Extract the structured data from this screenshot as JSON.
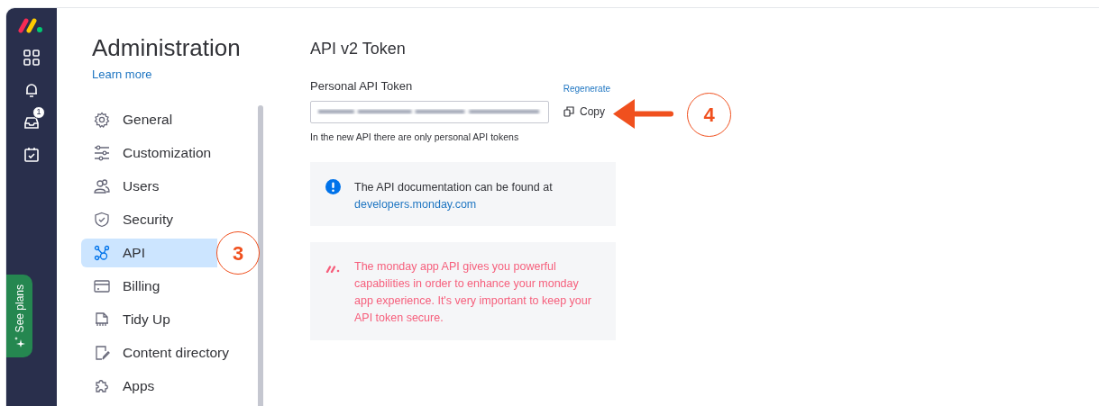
{
  "nav_rail": {
    "notification_badge": "1",
    "see_plans": "See plans"
  },
  "admin": {
    "title": "Administration",
    "learn_more": "Learn more",
    "items": [
      {
        "label": "General",
        "selected": false
      },
      {
        "label": "Customization",
        "selected": false
      },
      {
        "label": "Users",
        "selected": false
      },
      {
        "label": "Security",
        "selected": false
      },
      {
        "label": "API",
        "selected": true
      },
      {
        "label": "Billing",
        "selected": false
      },
      {
        "label": "Tidy Up",
        "selected": false
      },
      {
        "label": "Content directory",
        "selected": false
      },
      {
        "label": "Apps",
        "selected": false
      }
    ]
  },
  "main": {
    "title": "API v2 Token",
    "token_label": "Personal API Token",
    "regenerate": "Regenerate",
    "copy": "Copy",
    "hint": "In the new API there are only personal API tokens",
    "info": {
      "text": "The API documentation can be found at",
      "link": "developers.monday.com"
    },
    "notice": "The monday app API gives you powerful capabilities in order to enhance your monday app experience. It's very important to keep your API token secure."
  },
  "callouts": [
    {
      "label": "3"
    },
    {
      "label": "4"
    }
  ]
}
